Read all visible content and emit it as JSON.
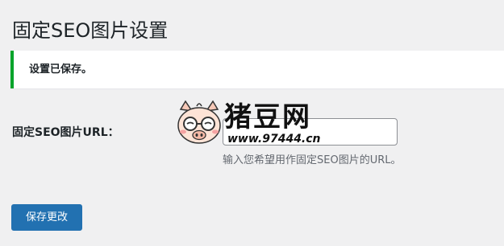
{
  "page": {
    "title": "固定SEO图片设置"
  },
  "notice": {
    "message": "设置已保存。",
    "color": "#00a32a"
  },
  "form": {
    "field_label": "固定SEO图片URL：",
    "url_value": "",
    "description": "输入您希望用作固定SEO图片的URL。"
  },
  "actions": {
    "save_label": "保存更改",
    "accent_color": "#2271b1"
  },
  "watermark": {
    "brand": "猪豆网",
    "url": "www.97444.cn",
    "icon": "pig-mascot-icon"
  }
}
